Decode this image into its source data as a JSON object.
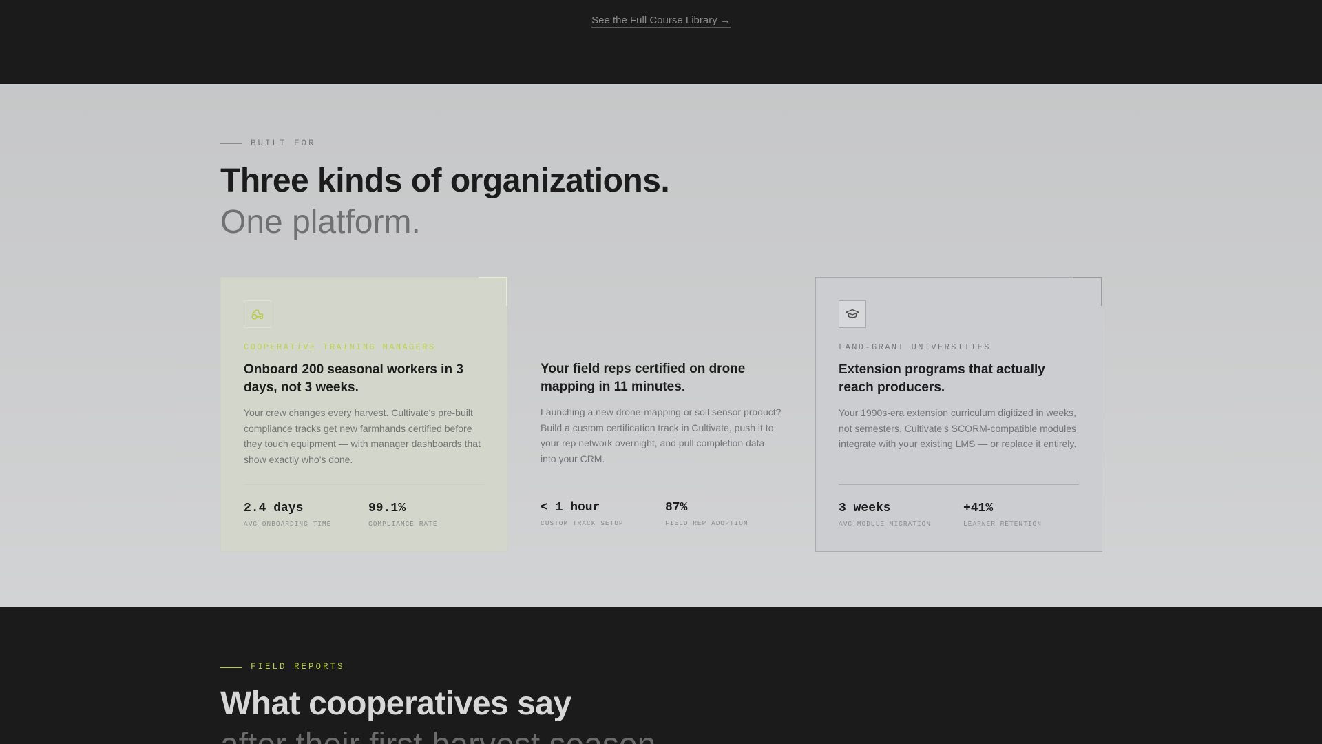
{
  "top": {
    "library_link": "See the Full Course Library →"
  },
  "built_for": {
    "eyebrow": "BUILT FOR",
    "title": "Three kinds of organizations.",
    "subtitle": "One platform."
  },
  "cards": [
    {
      "icon": "tractor-icon",
      "kicker": "COOPERATIVE TRAINING MANAGERS",
      "title": "Onboard 200 seasonal workers in 3 days, not 3 weeks.",
      "body": "Your crew changes every harvest. Cultivate's pre-built compliance tracks get new farmhands certified before they touch equipment — with manager dashboards that show exactly who's done.",
      "stats": [
        {
          "value": "2.4 days",
          "label": "AVG ONBOARDING TIME"
        },
        {
          "value": "99.1%",
          "label": "COMPLIANCE RATE"
        }
      ]
    },
    {
      "icon": "drone-icon",
      "kicker": "",
      "title": "Your field reps certified on drone mapping in 11 minutes.",
      "body": "Launching a new drone-mapping or soil sensor product? Build a custom certification track in Cultivate, push it to your rep network overnight, and pull completion data into your CRM.",
      "stats": [
        {
          "value": "< 1 hour",
          "label": "CUSTOM TRACK SETUP"
        },
        {
          "value": "87%",
          "label": "FIELD REP ADOPTION"
        }
      ]
    },
    {
      "icon": "graduation-cap-icon",
      "kicker": "LAND-GRANT UNIVERSITIES",
      "title": "Extension programs that actually reach producers.",
      "body": "Your 1990s-era extension curriculum digitized in weeks, not semesters. Cultivate's SCORM-compatible modules integrate with your existing LMS — or replace it entirely.",
      "stats": [
        {
          "value": "3 weeks",
          "label": "AVG MODULE MIGRATION"
        },
        {
          "value": "+41%",
          "label": "LEARNER RETENTION"
        }
      ]
    }
  ],
  "field_reports": {
    "eyebrow": "FIELD REPORTS",
    "title": "What cooperatives say",
    "subtitle": "after their first harvest season."
  },
  "colors": {
    "accent": "#b4cc3a",
    "dark_bg": "#1b1b1b",
    "light_bg": "#cccdce"
  }
}
